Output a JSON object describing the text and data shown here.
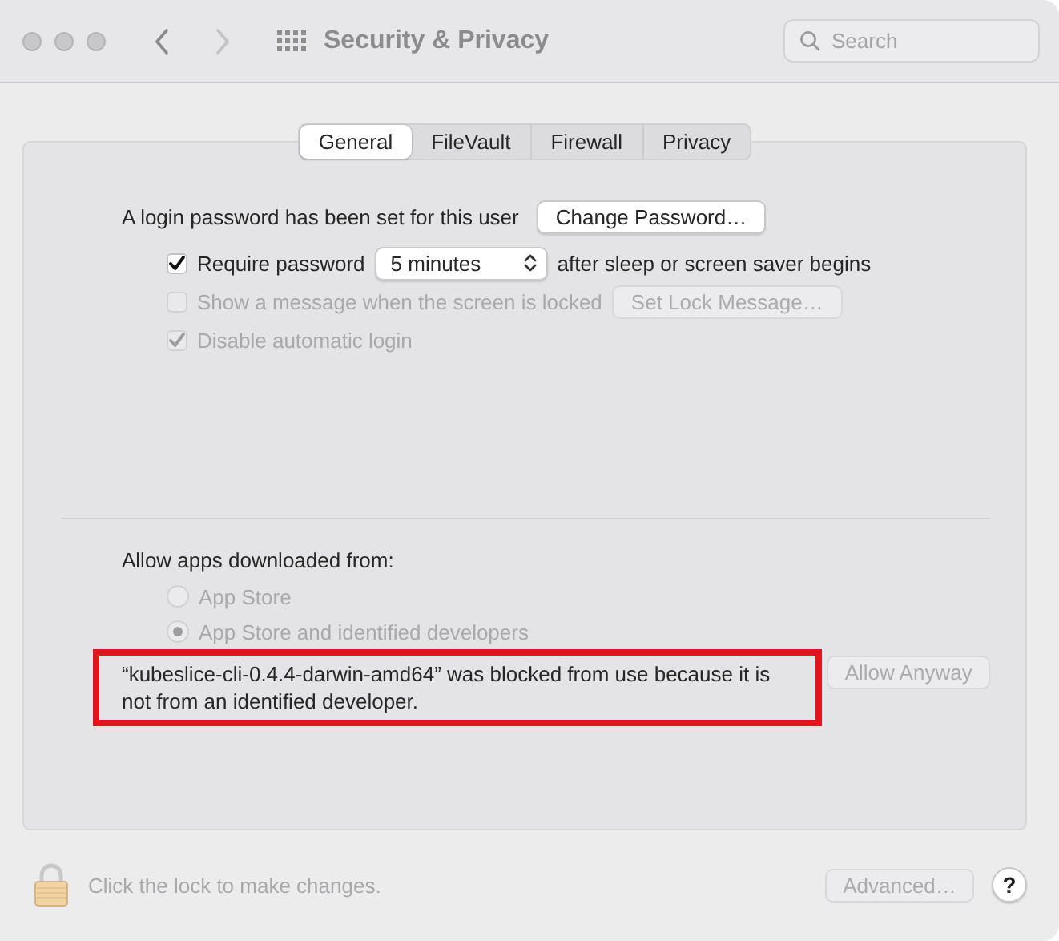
{
  "window": {
    "title": "Security & Privacy"
  },
  "search": {
    "placeholder": "Search"
  },
  "tabs": [
    {
      "label": "General",
      "selected": true
    },
    {
      "label": "FileVault",
      "selected": false
    },
    {
      "label": "Firewall",
      "selected": false
    },
    {
      "label": "Privacy",
      "selected": false
    }
  ],
  "login": {
    "label": "A login password has been set for this user",
    "button": "Change Password…"
  },
  "options": [
    {
      "kind": "popup",
      "label": "Require password",
      "checked": true,
      "disabled": false,
      "popup": "5 minutes",
      "suffix": "after sleep or screen saver begins"
    },
    {
      "kind": "button",
      "label": "Show a message when the screen is locked",
      "checked": false,
      "disabled": true,
      "button": "Set Lock Message…"
    },
    {
      "kind": "plain",
      "label": "Disable automatic login",
      "checked": true,
      "disabled": true
    }
  ],
  "gatekeeper": {
    "heading": "Allow apps downloaded from:",
    "sources": [
      {
        "label": "App Store",
        "selected": false,
        "disabled": true
      },
      {
        "label": "App Store and identified developers",
        "selected": true,
        "disabled": true
      }
    ],
    "blocked_message": "“kubeslice-cli-0.4.4-darwin-amd64” was blocked from use because it is not from an identified developer.",
    "allow_button": {
      "label": "Allow Anyway",
      "disabled": true
    }
  },
  "footer": {
    "lock_message": "Click the lock to make changes.",
    "advanced_button": {
      "label": "Advanced…",
      "disabled": true
    },
    "help_button": "?"
  }
}
